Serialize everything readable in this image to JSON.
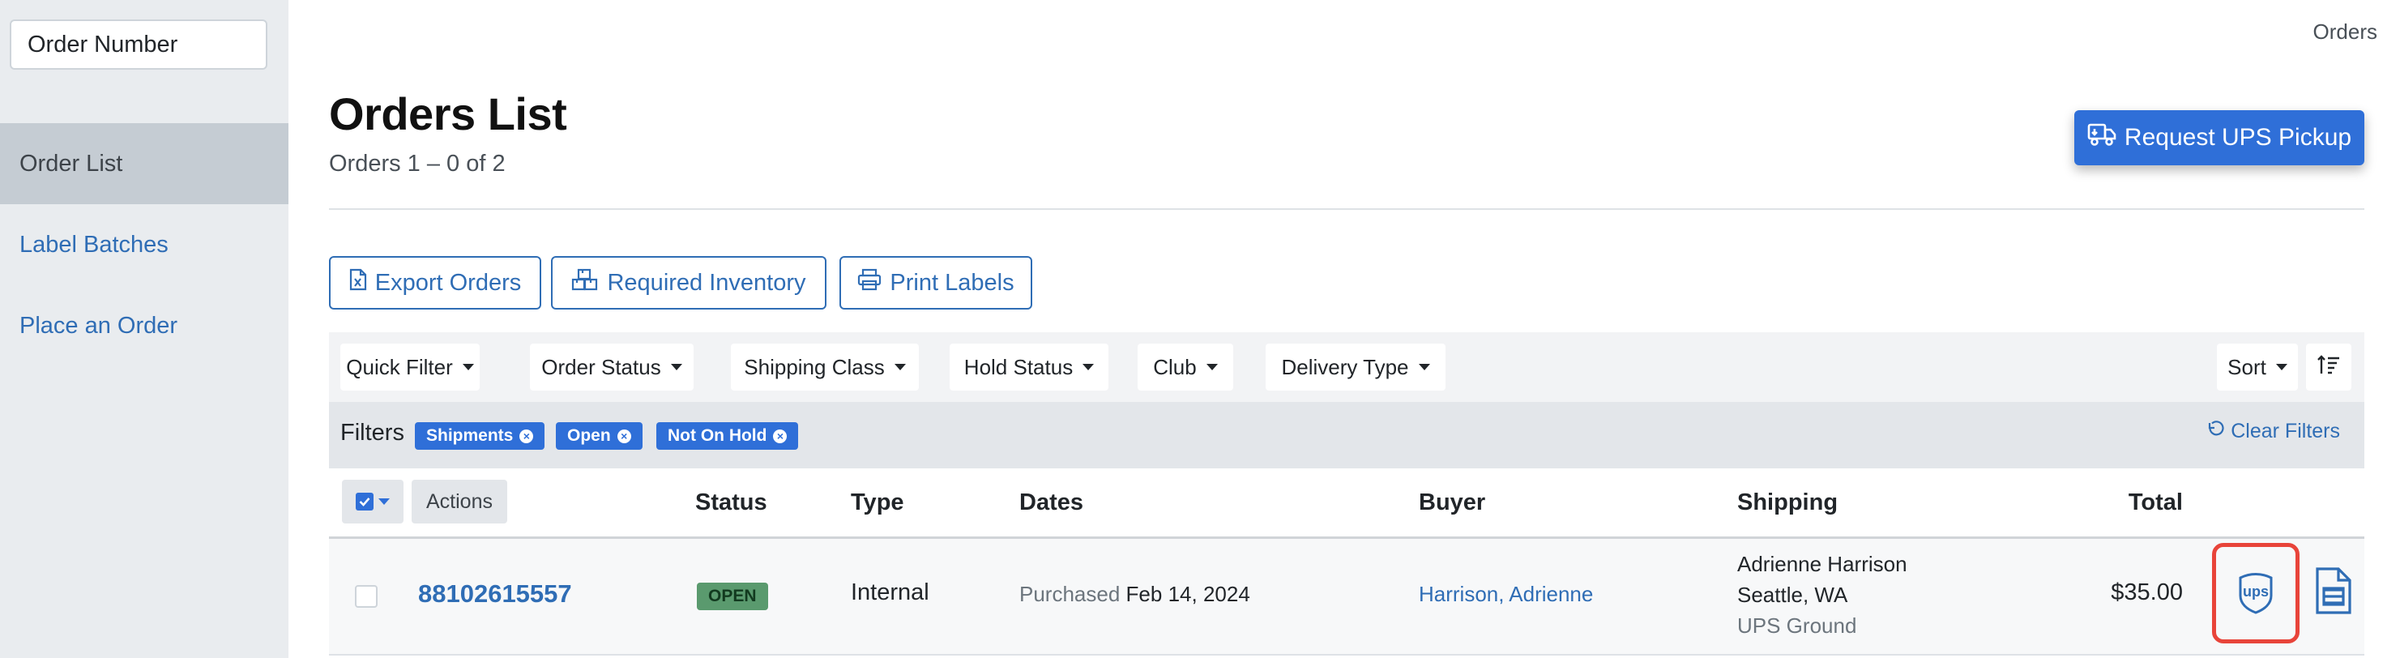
{
  "sidebar": {
    "search_placeholder": "Order Number",
    "items": [
      {
        "label": "Order List",
        "active": true
      },
      {
        "label": "Label Batches",
        "active": false
      },
      {
        "label": "Place an Order",
        "active": false
      }
    ]
  },
  "header": {
    "breadcrumb": "Orders",
    "title": "Orders List",
    "subtitle": "Orders 1 – 0 of 2",
    "pickup_button": "Request UPS Pickup"
  },
  "toolbar": {
    "export_label": "Export Orders",
    "inventory_label": "Required Inventory",
    "print_label": "Print Labels"
  },
  "filter_dropdowns": [
    "Quick Filter",
    "Order Status",
    "Shipping Class",
    "Hold Status",
    "Club",
    "Delivery Type"
  ],
  "sort_label": "Sort",
  "active_filters": {
    "label": "Filters",
    "chips": [
      "Shipments",
      "Open",
      "Not On Hold"
    ],
    "clear_label": "Clear Filters"
  },
  "table": {
    "actions_label": "Actions",
    "headers": {
      "status": "Status",
      "type": "Type",
      "dates": "Dates",
      "buyer": "Buyer",
      "shipping": "Shipping",
      "total": "Total"
    },
    "rows": [
      {
        "order_number": "88102615557",
        "status": "OPEN",
        "type": "Internal",
        "date_prefix": "Purchased",
        "date": "Feb 14, 2024",
        "buyer": "Harrison, Adrienne",
        "ship_name": "Adrienne Harrison",
        "ship_location": "Seattle, WA",
        "ship_method": "UPS Ground",
        "total": "$35.00",
        "ups_icon_text": "ups"
      }
    ]
  },
  "colors": {
    "primary": "#2f6fd8",
    "link": "#2f6db5",
    "sidebar_bg": "#e9ecef",
    "sidebar_active": "#c5ccd3",
    "status_open": "#5a9a6e",
    "highlight": "#e8443a"
  },
  "icons": [
    "truck-icon",
    "excel-file-icon",
    "boxes-icon",
    "printer-icon",
    "undo-icon",
    "ups-shield-icon",
    "document-icon",
    "sort-icon"
  ]
}
